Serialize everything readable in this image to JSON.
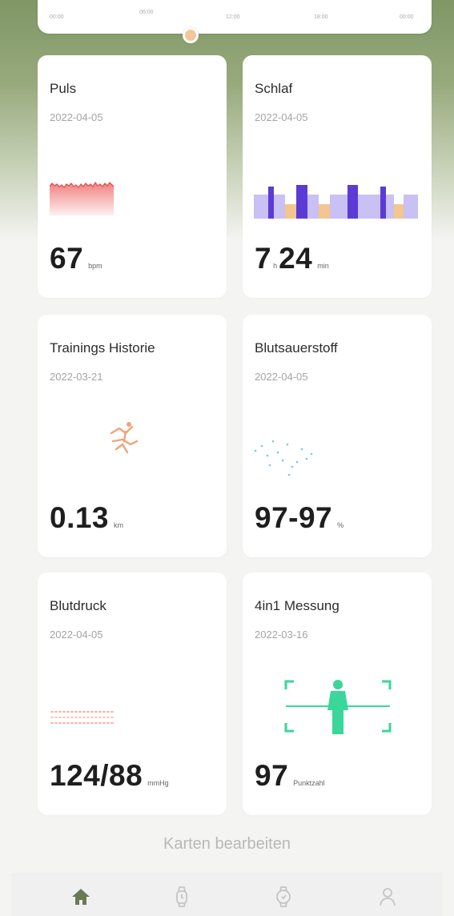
{
  "timeline": {
    "ticks": [
      "00:00",
      "06:00",
      "12:00",
      "18:00",
      "00:00"
    ]
  },
  "cards": [
    {
      "title": "Puls",
      "date": "2022-04-05",
      "value": "67",
      "unit": "bpm",
      "icon": "heart-rate-chart"
    },
    {
      "title": "Schlaf",
      "date": "2022-04-05",
      "hours": "7",
      "hours_unit": "h",
      "minutes": "24",
      "minutes_unit": "min",
      "icon": "sleep-bars-chart"
    },
    {
      "title": "Trainings Historie",
      "date": "2022-03-21",
      "value": "0.13",
      "unit": "km",
      "icon": "running-icon"
    },
    {
      "title": "Blutsauerstoff",
      "date": "2022-04-05",
      "value": "97-97",
      "unit": "%",
      "icon": "blood-oxygen-dots"
    },
    {
      "title": "Blutdruck",
      "date": "2022-04-05",
      "value": "124/88",
      "unit": "mmHg",
      "icon": "blood-pressure-chart"
    },
    {
      "title": "4in1 Messung",
      "date": "2022-03-16",
      "value": "97",
      "unit": "Punktzahl",
      "icon": "body-scan-icon"
    }
  ],
  "footer": {
    "edit_cards_label": "Karten bearbeiten"
  },
  "nav": {
    "items": [
      {
        "icon": "home-icon",
        "active": true
      },
      {
        "icon": "watch-icon",
        "active": false
      },
      {
        "icon": "watch-face-icon",
        "active": false
      },
      {
        "icon": "profile-icon",
        "active": false
      }
    ]
  },
  "colors": {
    "header_green": "#7f9665",
    "pulse_red": "#f06a6a",
    "sleep_deep": "#5b3bd6",
    "sleep_light": "#c9c0f3",
    "sleep_awake": "#f3c68f",
    "oxygen_blue": "#7fc6d8",
    "scan_green": "#3bd69a",
    "nav_active": "#6b7a55"
  }
}
